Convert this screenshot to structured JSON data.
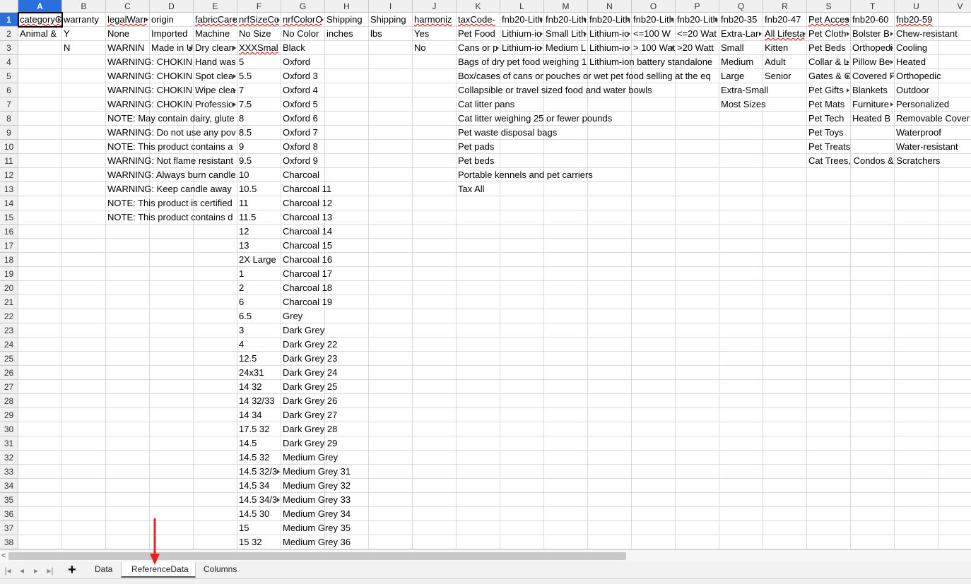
{
  "columns": [
    "A",
    "B",
    "C",
    "D",
    "E",
    "F",
    "G",
    "H",
    "I",
    "J",
    "K",
    "L",
    "M",
    "N",
    "O",
    "P",
    "Q",
    "R",
    "S",
    "T",
    "U",
    "V"
  ],
  "rows": [
    "1",
    "2",
    "3",
    "4",
    "5",
    "6",
    "7",
    "8",
    "9",
    "10",
    "11",
    "12",
    "13",
    "14",
    "15",
    "16",
    "17",
    "18",
    "19",
    "20",
    "21",
    "22",
    "23",
    "24",
    "25",
    "26",
    "27",
    "28",
    "29",
    "30",
    "31",
    "32",
    "33",
    "34",
    "35",
    "36",
    "37",
    "38"
  ],
  "cells": {
    "A": [
      "categoryC",
      "Animal &"
    ],
    "B": [
      "warranty",
      "Y",
      "N"
    ],
    "C": [
      "legalWarr",
      "None",
      "WARNIN",
      "WARNING: CHOKIN",
      "WARNING: CHOKIN",
      "WARNING: CHOKIN",
      "WARNING: CHOKIN",
      "NOTE: May contain dairy, glute",
      "WARNING: Do not use any pov",
      "NOTE: This product contains a",
      "WARNING: Not flame resistant",
      "WARNING: Always burn candle",
      "WARNING: Keep candle away",
      "NOTE: This product is certified",
      "NOTE: This product contains d"
    ],
    "D": [
      "origin",
      "Imported",
      "Made in U"
    ],
    "E": [
      "fabricCare",
      "Machine",
      "Dry clean",
      "Hand was",
      "Spot clea",
      "Wipe clea",
      "Professio"
    ],
    "F": [
      "nrfSizeCo",
      "No Size",
      "XXXSmal",
      "5",
      "5.5",
      "7",
      "7.5",
      "8",
      "8.5",
      "9",
      "9.5",
      "10",
      "10.5",
      "11",
      "11.5",
      "12",
      "13",
      "2X Large",
      "1",
      "2",
      "6",
      "6.5",
      "3",
      "4",
      "12.5",
      "24x31",
      "14 32",
      "14 32/33",
      "14 34",
      "17.5 32",
      "14.5",
      "14.5 32",
      "14.5 32/3",
      "14.5 34",
      "14.5 34/3",
      "14.5 30",
      "15",
      "15 32"
    ],
    "G": [
      "nrfColorC",
      "No Color",
      "Black",
      "Oxford",
      "Oxford 3",
      "Oxford 4",
      "Oxford 5",
      "Oxford 6",
      "Oxford 7",
      "Oxford 8",
      "Oxford 9",
      "Charcoal",
      "Charcoal 11",
      "Charcoal 12",
      "Charcoal 13",
      "Charcoal 14",
      "Charcoal 15",
      "Charcoal 16",
      "Charcoal 17",
      "Charcoal 18",
      "Charcoal 19",
      "Grey",
      "Dark Grey",
      "Dark Grey 22",
      "Dark Grey 23",
      "Dark Grey 24",
      "Dark Grey 25",
      "Dark Grey 26",
      "Dark Grey 27",
      "Dark Grey 28",
      "Dark Grey 29",
      "Medium Grey",
      "Medium Grey 31",
      "Medium Grey 32",
      "Medium Grey 33",
      "Medium Grey 34",
      "Medium Grey 35",
      "Medium Grey 36"
    ],
    "H": [
      "Shipping",
      "inches"
    ],
    "I": [
      "Shipping",
      "lbs"
    ],
    "J": [
      "harmoniz",
      "Yes",
      "No"
    ],
    "K": [
      "taxCode-",
      "Pet Food",
      "Cans or p",
      "Bags of dry pet food weighing 1",
      "Box/cases of cans or pouches or wet pet food selling at the eq",
      "Collapsible or travel sized food and water bowls",
      "Cat litter pans",
      "Cat litter weighing 25 or fewer pounds",
      "Pet waste disposal bags",
      "Pet pads",
      "Pet beds",
      "Portable kennels and pet carriers",
      "Tax All"
    ],
    "L": [
      "fnb20-Lith",
      "Lithium-io",
      "Lithium-io"
    ],
    "M": [
      "fnb20-Lith",
      "Small Lith",
      "Medium L"
    ],
    "N": [
      "fnb20-Lith",
      "Lithium-io",
      "Lithium-io",
      "Lithium-ion battery standalone"
    ],
    "O": [
      "fnb20-Lith",
      "<=100 W",
      "> 100 Wat"
    ],
    "P": [
      "fnb20-Lith",
      "<=20 Wat",
      ">20 Watt"
    ],
    "Q": [
      "fnb20-35",
      "Extra-Lar",
      "Small",
      "Medium",
      "Large",
      "Extra-Small",
      "Most Sizes"
    ],
    "R": [
      "fnb20-47",
      "All Lifesta",
      "Kitten",
      "Adult",
      "Senior"
    ],
    "S": [
      "Pet Acces",
      "Pet Cloth",
      "Pet Beds",
      "Collar & L",
      "Gates & C",
      "Pet Gifts",
      "Pet Mats",
      "Pet Tech",
      "Pet Toys",
      "Pet Treats",
      "Cat Trees, Condos & Scratchers"
    ],
    "T": [
      "fnb20-60",
      "Bolster B",
      "Orthopedi",
      "Pillow Be",
      "Covered P",
      "Blankets",
      "Furniture",
      "Heated B"
    ],
    "U": [
      "fnb20-59",
      "Chew-resistant",
      "Cooling",
      "Heated",
      "Orthopedic",
      "Outdoor",
      "Personalized",
      "Removable Cover",
      "Waterproof",
      "Water-resistant"
    ]
  },
  "sheets": {
    "add_label": "+",
    "tabs": [
      "Data",
      "ReferenceData",
      "Columns"
    ],
    "active": "ReferenceData"
  },
  "nav_icons": [
    "first-sheet-icon",
    "prev-sheet-icon",
    "next-sheet-icon",
    "last-sheet-icon"
  ],
  "annotation_color": "#e8201c"
}
